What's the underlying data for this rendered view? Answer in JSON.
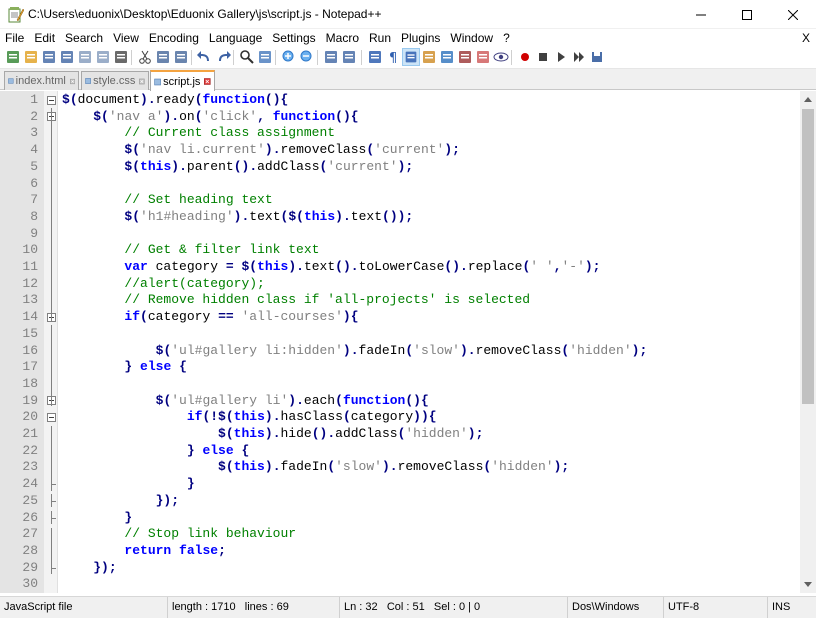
{
  "window": {
    "title": "C:\\Users\\eduonix\\Desktop\\Eduonix Gallery\\js\\script.js - Notepad++"
  },
  "menu": {
    "items": [
      "File",
      "Edit",
      "Search",
      "View",
      "Encoding",
      "Language",
      "Settings",
      "Macro",
      "Run",
      "Plugins",
      "Window",
      "?"
    ],
    "close_label": "X"
  },
  "toolbar": {
    "icons": [
      "new-file-icon",
      "open-file-icon",
      "save-icon",
      "save-all-icon",
      "close-icon",
      "close-all-icon",
      "print-icon",
      "cut-icon",
      "copy-icon",
      "paste-icon",
      "undo-icon",
      "redo-icon",
      "find-icon",
      "replace-icon",
      "zoom-in-icon",
      "zoom-out-icon",
      "sync-vertical-icon",
      "sync-horizontal-icon",
      "word-wrap-icon",
      "show-all-chars-icon",
      "indent-guide-icon",
      "user-language-icon",
      "document-map-icon",
      "function-list-icon",
      "folder-workspace-icon",
      "monitoring-icon",
      "record-macro-icon",
      "stop-recording-icon",
      "playback-macro-icon",
      "run-macro-multiple-icon",
      "save-macro-icon"
    ]
  },
  "tabs": [
    {
      "label": "index.html",
      "active": false,
      "color": "#e44d26"
    },
    {
      "label": "style.css",
      "active": false,
      "color": "#2965f1"
    },
    {
      "label": "script.js",
      "active": true,
      "color": "#f0db4f"
    }
  ],
  "editor": {
    "line_numbers": [
      "1",
      "2",
      "3",
      "4",
      "5",
      "6",
      "7",
      "8",
      "9",
      "10",
      "11",
      "12",
      "13",
      "14",
      "15",
      "16",
      "17",
      "18",
      "19",
      "20",
      "21",
      "22",
      "23",
      "24",
      "25",
      "26",
      "27",
      "28",
      "29",
      "30"
    ],
    "lines": [
      [
        [
          "$",
          "op"
        ],
        [
          "(",
          "op"
        ],
        [
          "document",
          "id"
        ],
        [
          ")",
          "op"
        ],
        [
          ".",
          "op"
        ],
        [
          "ready",
          "fn"
        ],
        [
          "(",
          "op"
        ],
        [
          "function",
          "kw"
        ],
        [
          "()",
          "op"
        ],
        [
          "{",
          "op"
        ]
      ],
      [
        [
          "    ",
          "id"
        ],
        [
          "$",
          "op"
        ],
        [
          "(",
          "op"
        ],
        [
          "'nav a'",
          "str"
        ],
        [
          ")",
          "op"
        ],
        [
          ".",
          "op"
        ],
        [
          "on",
          "fn"
        ],
        [
          "(",
          "op"
        ],
        [
          "'click'",
          "str"
        ],
        [
          ", ",
          "op"
        ],
        [
          "function",
          "kw"
        ],
        [
          "()",
          "op"
        ],
        [
          "{",
          "op"
        ]
      ],
      [
        [
          "        ",
          "id"
        ],
        [
          "// Current class assignment",
          "cm"
        ]
      ],
      [
        [
          "        ",
          "id"
        ],
        [
          "$",
          "op"
        ],
        [
          "(",
          "op"
        ],
        [
          "'nav li.current'",
          "str"
        ],
        [
          ")",
          "op"
        ],
        [
          ".",
          "op"
        ],
        [
          "removeClass",
          "fn"
        ],
        [
          "(",
          "op"
        ],
        [
          "'current'",
          "str"
        ],
        [
          ");",
          "op"
        ]
      ],
      [
        [
          "        ",
          "id"
        ],
        [
          "$",
          "op"
        ],
        [
          "(",
          "op"
        ],
        [
          "this",
          "kw"
        ],
        [
          ")",
          "op"
        ],
        [
          ".",
          "op"
        ],
        [
          "parent",
          "fn"
        ],
        [
          "()",
          "op"
        ],
        [
          ".",
          "op"
        ],
        [
          "addClass",
          "fn"
        ],
        [
          "(",
          "op"
        ],
        [
          "'current'",
          "str"
        ],
        [
          ");",
          "op"
        ]
      ],
      [
        [
          "",
          "id"
        ]
      ],
      [
        [
          "        ",
          "id"
        ],
        [
          "// Set heading text",
          "cm"
        ]
      ],
      [
        [
          "        ",
          "id"
        ],
        [
          "$",
          "op"
        ],
        [
          "(",
          "op"
        ],
        [
          "'h1#heading'",
          "str"
        ],
        [
          ")",
          "op"
        ],
        [
          ".",
          "op"
        ],
        [
          "text",
          "fn"
        ],
        [
          "(",
          "op"
        ],
        [
          "$",
          "op"
        ],
        [
          "(",
          "op"
        ],
        [
          "this",
          "kw"
        ],
        [
          ")",
          "op"
        ],
        [
          ".",
          "op"
        ],
        [
          "text",
          "fn"
        ],
        [
          "());",
          "op"
        ]
      ],
      [
        [
          "",
          "id"
        ]
      ],
      [
        [
          "        ",
          "id"
        ],
        [
          "// Get & filter link text",
          "cm"
        ]
      ],
      [
        [
          "        ",
          "id"
        ],
        [
          "var",
          "kw"
        ],
        [
          " category ",
          "id"
        ],
        [
          "=",
          "op"
        ],
        [
          " ",
          "id"
        ],
        [
          "$",
          "op"
        ],
        [
          "(",
          "op"
        ],
        [
          "this",
          "kw"
        ],
        [
          ")",
          "op"
        ],
        [
          ".",
          "op"
        ],
        [
          "text",
          "fn"
        ],
        [
          "()",
          "op"
        ],
        [
          ".",
          "op"
        ],
        [
          "toLowerCase",
          "fn"
        ],
        [
          "()",
          "op"
        ],
        [
          ".",
          "op"
        ],
        [
          "replace",
          "fn"
        ],
        [
          "(",
          "op"
        ],
        [
          "' '",
          "str"
        ],
        [
          ",",
          "op"
        ],
        [
          "'-'",
          "str"
        ],
        [
          ");",
          "op"
        ]
      ],
      [
        [
          "        ",
          "id"
        ],
        [
          "//alert(category);",
          "cm"
        ]
      ],
      [
        [
          "        ",
          "id"
        ],
        [
          "// Remove hidden class if 'all-projects' is selected",
          "cm"
        ]
      ],
      [
        [
          "        ",
          "id"
        ],
        [
          "if",
          "kw"
        ],
        [
          "(",
          "op"
        ],
        [
          "category ",
          "id"
        ],
        [
          "==",
          "op"
        ],
        [
          " ",
          "id"
        ],
        [
          "'all-courses'",
          "str"
        ],
        [
          "){",
          "op"
        ]
      ],
      [
        [
          "",
          "id"
        ]
      ],
      [
        [
          "            ",
          "id"
        ],
        [
          "$",
          "op"
        ],
        [
          "(",
          "op"
        ],
        [
          "'ul#gallery li:hidden'",
          "str"
        ],
        [
          ")",
          "op"
        ],
        [
          ".",
          "op"
        ],
        [
          "fadeIn",
          "fn"
        ],
        [
          "(",
          "op"
        ],
        [
          "'slow'",
          "str"
        ],
        [
          ")",
          "op"
        ],
        [
          ".",
          "op"
        ],
        [
          "removeClass",
          "fn"
        ],
        [
          "(",
          "op"
        ],
        [
          "'hidden'",
          "str"
        ],
        [
          ");",
          "op"
        ]
      ],
      [
        [
          "        ",
          "id"
        ],
        [
          "}",
          "op"
        ],
        [
          " ",
          "id"
        ],
        [
          "else",
          "kw"
        ],
        [
          " ",
          "id"
        ],
        [
          "{",
          "op"
        ]
      ],
      [
        [
          "",
          "id"
        ]
      ],
      [
        [
          "            ",
          "id"
        ],
        [
          "$",
          "op"
        ],
        [
          "(",
          "op"
        ],
        [
          "'ul#gallery li'",
          "str"
        ],
        [
          ")",
          "op"
        ],
        [
          ".",
          "op"
        ],
        [
          "each",
          "fn"
        ],
        [
          "(",
          "op"
        ],
        [
          "function",
          "kw"
        ],
        [
          "(){",
          "op"
        ]
      ],
      [
        [
          "                ",
          "id"
        ],
        [
          "if",
          "kw"
        ],
        [
          "(!",
          "op"
        ],
        [
          "$",
          "op"
        ],
        [
          "(",
          "op"
        ],
        [
          "this",
          "kw"
        ],
        [
          ")",
          "op"
        ],
        [
          ".",
          "op"
        ],
        [
          "hasClass",
          "fn"
        ],
        [
          "(",
          "op"
        ],
        [
          "category",
          "id"
        ],
        [
          ")){",
          "op"
        ]
      ],
      [
        [
          "                    ",
          "id"
        ],
        [
          "$",
          "op"
        ],
        [
          "(",
          "op"
        ],
        [
          "this",
          "kw"
        ],
        [
          ")",
          "op"
        ],
        [
          ".",
          "op"
        ],
        [
          "hide",
          "fn"
        ],
        [
          "()",
          "op"
        ],
        [
          ".",
          "op"
        ],
        [
          "addClass",
          "fn"
        ],
        [
          "(",
          "op"
        ],
        [
          "'hidden'",
          "str"
        ],
        [
          ");",
          "op"
        ]
      ],
      [
        [
          "                ",
          "id"
        ],
        [
          "}",
          "op"
        ],
        [
          " ",
          "id"
        ],
        [
          "else",
          "kw"
        ],
        [
          " ",
          "id"
        ],
        [
          "{",
          "op"
        ]
      ],
      [
        [
          "                    ",
          "id"
        ],
        [
          "$",
          "op"
        ],
        [
          "(",
          "op"
        ],
        [
          "this",
          "kw"
        ],
        [
          ")",
          "op"
        ],
        [
          ".",
          "op"
        ],
        [
          "fadeIn",
          "fn"
        ],
        [
          "(",
          "op"
        ],
        [
          "'slow'",
          "str"
        ],
        [
          ")",
          "op"
        ],
        [
          ".",
          "op"
        ],
        [
          "removeClass",
          "fn"
        ],
        [
          "(",
          "op"
        ],
        [
          "'hidden'",
          "str"
        ],
        [
          ");",
          "op"
        ]
      ],
      [
        [
          "                ",
          "id"
        ],
        [
          "}",
          "op"
        ]
      ],
      [
        [
          "            ",
          "id"
        ],
        [
          "});",
          "op"
        ]
      ],
      [
        [
          "        ",
          "id"
        ],
        [
          "}",
          "op"
        ]
      ],
      [
        [
          "        ",
          "id"
        ],
        [
          "// Stop link behaviour",
          "cm"
        ]
      ],
      [
        [
          "        ",
          "id"
        ],
        [
          "return",
          "kw"
        ],
        [
          " ",
          "id"
        ],
        [
          "false",
          "kw"
        ],
        [
          ";",
          "op"
        ]
      ],
      [
        [
          "    ",
          "id"
        ],
        [
          "});",
          "op"
        ]
      ],
      [
        [
          "",
          "id"
        ]
      ]
    ],
    "token_colors": {
      "kw": "#0000ff",
      "op": "#000080",
      "str": "#808080",
      "cm": "#008000",
      "fn": "#000000",
      "id": "#000000"
    }
  },
  "status": {
    "language": "JavaScript file",
    "length": "length : 1710",
    "lines": "lines : 69",
    "ln": "Ln : 32",
    "col": "Col : 51",
    "sel": "Sel : 0 | 0",
    "eol": "Dos\\Windows",
    "encoding": "UTF-8",
    "mode": "INS"
  }
}
